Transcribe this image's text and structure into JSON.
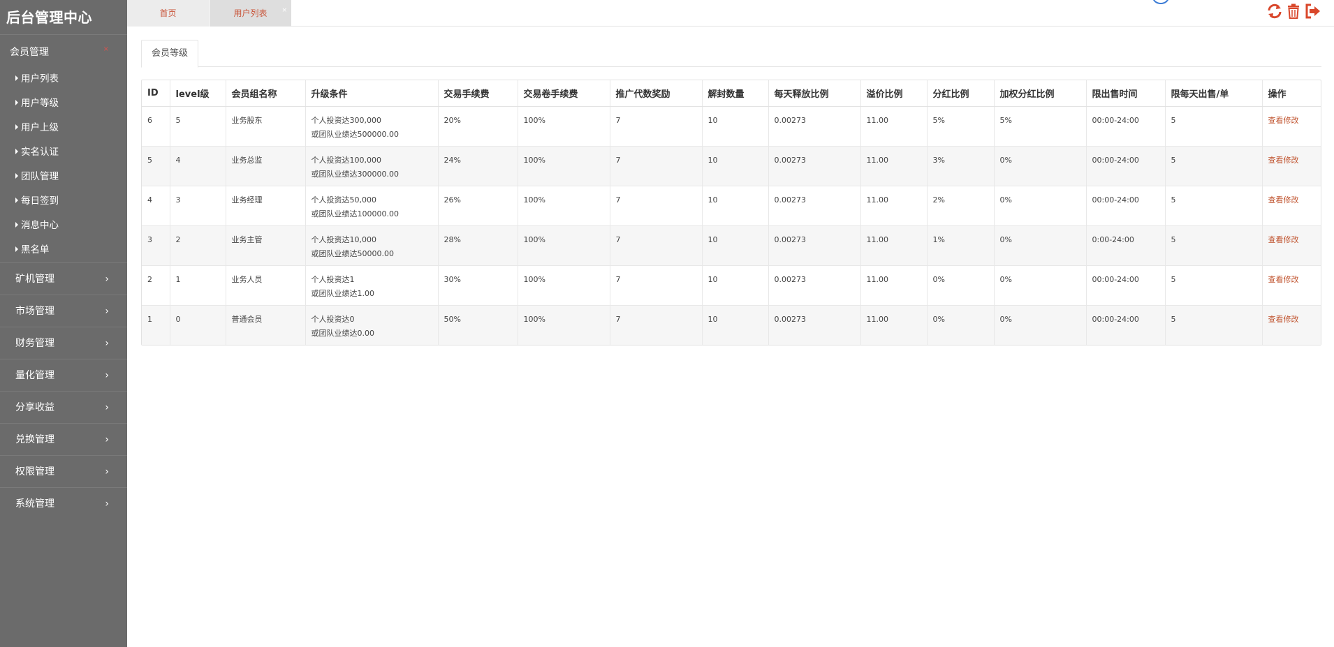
{
  "app": {
    "title": "后台管理中心"
  },
  "sidebar": {
    "open_menu": {
      "label": "会员管理",
      "close_glyph": "×"
    },
    "sub_items": [
      {
        "label": "用户列表"
      },
      {
        "label": "用户等级"
      },
      {
        "label": "用户上级"
      },
      {
        "label": "实名认证"
      },
      {
        "label": "团队管理"
      },
      {
        "label": "每日签到"
      },
      {
        "label": "消息中心"
      },
      {
        "label": "黑名单"
      }
    ],
    "menus": [
      {
        "label": "矿机管理"
      },
      {
        "label": "市场管理"
      },
      {
        "label": "财务管理"
      },
      {
        "label": "量化管理"
      },
      {
        "label": "分享收益"
      },
      {
        "label": "兑换管理"
      },
      {
        "label": "权限管理"
      },
      {
        "label": "系统管理"
      }
    ]
  },
  "tabs": {
    "home": "首页",
    "users": "用户列表",
    "close_glyph": "×"
  },
  "toolbar": {
    "icons": [
      "refresh-icon",
      "trash-icon",
      "logout-icon"
    ],
    "accent": "#d9472b"
  },
  "content_tab": {
    "label": "会员等级"
  },
  "table": {
    "headers": [
      "ID",
      "level级",
      "会员组名称",
      "升级条件",
      "交易手续费",
      "交易卷手续费",
      "推广代数奖励",
      "解封数量",
      "每天释放比例",
      "溢价比例",
      "分红比例",
      "加权分红比例",
      "限出售时间",
      "限每天出售/单",
      "操作"
    ],
    "rows": [
      {
        "id": "6",
        "level": "5",
        "name": "业务股东",
        "cond1": "个人投资达300,000",
        "cond2": "或团队业绩达500000.00",
        "fee": "20%",
        "vfee": "100%",
        "reward": "7",
        "unlock": "10",
        "release": "0.00273",
        "premium": "11.00",
        "dividend": "5%",
        "wdividend": "5%",
        "time": "00:00-24:00",
        "limit": "5",
        "action": "查看修改"
      },
      {
        "id": "5",
        "level": "4",
        "name": "业务总监",
        "cond1": "个人投资达100,000",
        "cond2": "或团队业绩达300000.00",
        "fee": "24%",
        "vfee": "100%",
        "reward": "7",
        "unlock": "10",
        "release": "0.00273",
        "premium": "11.00",
        "dividend": "3%",
        "wdividend": "0%",
        "time": "00:00-24:00",
        "limit": "5",
        "action": "查看修改"
      },
      {
        "id": "4",
        "level": "3",
        "name": "业务经理",
        "cond1": "个人投资达50,000",
        "cond2": "或团队业绩达100000.00",
        "fee": "26%",
        "vfee": "100%",
        "reward": "7",
        "unlock": "10",
        "release": "0.00273",
        "premium": "11.00",
        "dividend": "2%",
        "wdividend": "0%",
        "time": "00:00-24:00",
        "limit": "5",
        "action": "查看修改"
      },
      {
        "id": "3",
        "level": "2",
        "name": "业务主管",
        "cond1": "个人投资达10,000",
        "cond2": "或团队业绩达50000.00",
        "fee": "28%",
        "vfee": "100%",
        "reward": "7",
        "unlock": "10",
        "release": "0.00273",
        "premium": "11.00",
        "dividend": "1%",
        "wdividend": "0%",
        "time": "0:00-24:00",
        "limit": "5",
        "action": "查看修改"
      },
      {
        "id": "2",
        "level": "1",
        "name": "业务人员",
        "cond1": "个人投资达1",
        "cond2": "或团队业绩达1.00",
        "fee": "30%",
        "vfee": "100%",
        "reward": "7",
        "unlock": "10",
        "release": "0.00273",
        "premium": "11.00",
        "dividend": "0%",
        "wdividend": "0%",
        "time": "00:00-24:00",
        "limit": "5",
        "action": "查看修改"
      },
      {
        "id": "1",
        "level": "0",
        "name": "普通会员",
        "cond1": "个人投资达0",
        "cond2": "或团队业绩达0.00",
        "fee": "50%",
        "vfee": "100%",
        "reward": "7",
        "unlock": "10",
        "release": "0.00273",
        "premium": "11.00",
        "dividend": "0%",
        "wdividend": "0%",
        "time": "00:00-24:00",
        "limit": "5",
        "action": "查看修改"
      }
    ]
  }
}
